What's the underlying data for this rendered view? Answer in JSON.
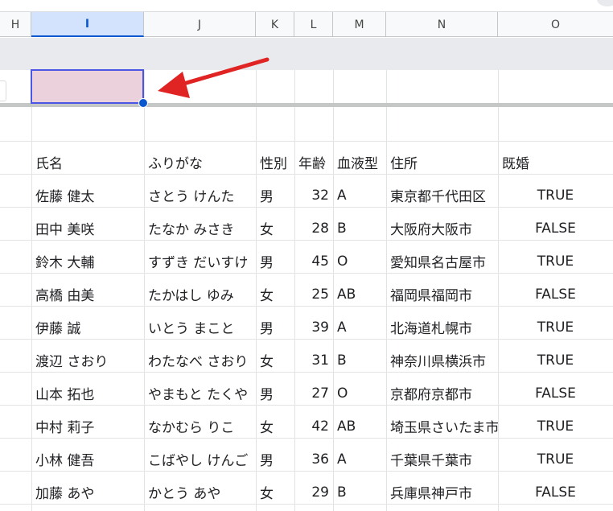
{
  "columns": [
    "H",
    "I",
    "J",
    "K",
    "L",
    "M",
    "N",
    "O"
  ],
  "selected_column": "I",
  "headers": {
    "name": "氏名",
    "furigana": "ふりがな",
    "gender": "性別",
    "age": "年齢",
    "blood": "血液型",
    "address": "住所",
    "married": "既婚"
  },
  "rows": [
    {
      "name": "佐藤 健太",
      "furigana": "さとう けんた",
      "gender": "男",
      "age": "32",
      "blood": "A",
      "address": "東京都千代田区",
      "married": "TRUE"
    },
    {
      "name": "田中 美咲",
      "furigana": "たなか みさき",
      "gender": "女",
      "age": "28",
      "blood": "B",
      "address": "大阪府大阪市",
      "married": "FALSE"
    },
    {
      "name": "鈴木 大輔",
      "furigana": "すずき だいすけ",
      "gender": "男",
      "age": "45",
      "blood": "O",
      "address": "愛知県名古屋市",
      "married": "TRUE"
    },
    {
      "name": "高橋 由美",
      "furigana": "たかはし ゆみ",
      "gender": "女",
      "age": "25",
      "blood": "AB",
      "address": "福岡県福岡市",
      "married": "FALSE"
    },
    {
      "name": "伊藤 誠",
      "furigana": "いとう まこと",
      "gender": "男",
      "age": "39",
      "blood": "A",
      "address": "北海道札幌市",
      "married": "TRUE"
    },
    {
      "name": "渡辺 さおり",
      "furigana": "わたなべ さおり",
      "gender": "女",
      "age": "31",
      "blood": "B",
      "address": "神奈川県横浜市",
      "married": "TRUE"
    },
    {
      "name": "山本 拓也",
      "furigana": "やまもと たくや",
      "gender": "男",
      "age": "27",
      "blood": "O",
      "address": "京都府京都市",
      "married": "FALSE"
    },
    {
      "name": "中村 莉子",
      "furigana": "なかむら りこ",
      "gender": "女",
      "age": "42",
      "blood": "AB",
      "address": "埼玉県さいたま市",
      "married": "TRUE"
    },
    {
      "name": "小林 健吾",
      "furigana": "こばやし けんご",
      "gender": "男",
      "age": "36",
      "blood": "A",
      "address": "千葉県千葉市",
      "married": "TRUE"
    },
    {
      "name": "加藤 あや",
      "furigana": "かとう あや",
      "gender": "女",
      "age": "29",
      "blood": "B",
      "address": "兵庫県神戸市",
      "married": "FALSE"
    }
  ],
  "colors": {
    "selected_fill": "#ead1dc",
    "selection_border": "#4b57e4",
    "arrow": "#e02424",
    "header_selected": "#d3e3fd"
  },
  "icons": {
    "pointer": "red-arrow-icon",
    "fill_handle": "fill-handle-icon"
  }
}
